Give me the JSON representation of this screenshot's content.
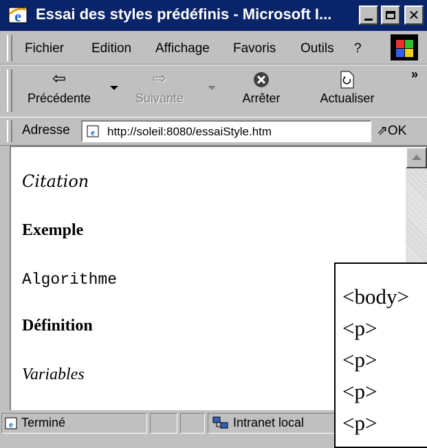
{
  "window": {
    "title": "Essai des styles prédéfinis - Microsoft I...",
    "icon": "ie-icon",
    "title_bar_color": "#0a246a"
  },
  "menu": {
    "items": [
      "Fichier",
      "Edition",
      "Affichage",
      "Favoris",
      "Outils",
      "?"
    ]
  },
  "toolbar": {
    "back_label": "Précédente",
    "forward_label": "Suivante",
    "stop_label": "Arrêter",
    "refresh_label": "Actualiser",
    "more": "»"
  },
  "address": {
    "label": "Adresse",
    "url": "http://soleil:8080/essaiStyle.htm",
    "go_label": "OK"
  },
  "content": {
    "citation": "Citation",
    "exemple": "Exemple",
    "algorithme": "Algorithme",
    "definition": "Définition",
    "variables": "Variables"
  },
  "status": {
    "text": "Terminé",
    "zone": "Intranet local"
  },
  "overlay": {
    "lines": [
      "<body>",
      "<p>",
      "<p>",
      "<p>",
      "<p>"
    ]
  }
}
